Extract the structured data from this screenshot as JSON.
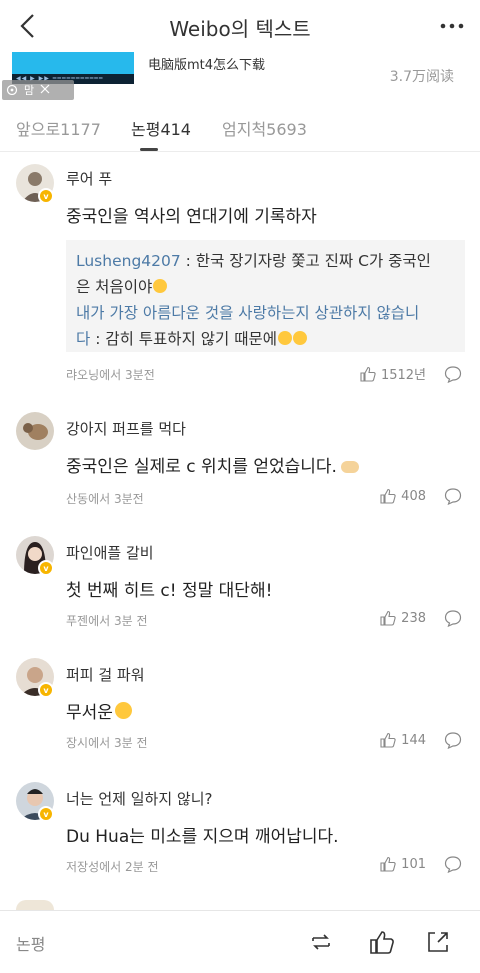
{
  "header": {
    "title": "Weibo의 텍스트",
    "back_icon": "chevron-left-icon",
    "more_icon": "more-dots-icon"
  },
  "source": {
    "title": "电脑版mt4怎么下载",
    "reads": "3.7万阅读",
    "badge_text": "맘"
  },
  "tabs": [
    {
      "label": "앞으로1177",
      "active": false
    },
    {
      "label": "논평414",
      "active": true
    },
    {
      "label": "엄지척5693",
      "active": false
    }
  ],
  "comments": [
    {
      "user": "루어 푸",
      "text": "중국인을 역사의 연대기에 기록하자",
      "quote": {
        "author": "Lusheng4207",
        "line1_rest": " : 한국 장기자랑 쫓고 진짜 C가 중국인",
        "line2": "은 처음이야",
        "link_text_line3": "내가 가장 아름다운 것을 사랑하는지 상관하지 않습니",
        "link_text_line4": "다",
        "line4_rest": " : 감히 투표하지 않기 때문에"
      },
      "meta": "랴오닝에서 3분전",
      "likes": "1512년"
    },
    {
      "user": "강아지 퍼프를 먹다",
      "text": "중국인은 실제로 c 위치를 얻었습니다.",
      "meta": "산동에서 3분전",
      "likes": "408"
    },
    {
      "user": "파인애플 갈비",
      "text": "첫 번째 히트 c! 정말 대단해!",
      "meta": "푸젠에서 3분 전",
      "likes": "238"
    },
    {
      "user": "퍼피 걸 파워",
      "text": "무서운",
      "meta": "장시에서 3분 전",
      "likes": "144"
    },
    {
      "user": "너는 언제 일하지 않니?",
      "text": "Du Hua는 미소를 지으며 깨어납니다.",
      "meta": "저장성에서 2분 전",
      "likes": "101"
    }
  ],
  "bottom_bar": {
    "comment_label": "논평",
    "icons": [
      "repost-icon",
      "thumbs-up-icon",
      "share-icon"
    ]
  },
  "colors": {
    "link": "#4d7aa6",
    "muted": "#999999",
    "verified_badge": "#f7b500"
  }
}
